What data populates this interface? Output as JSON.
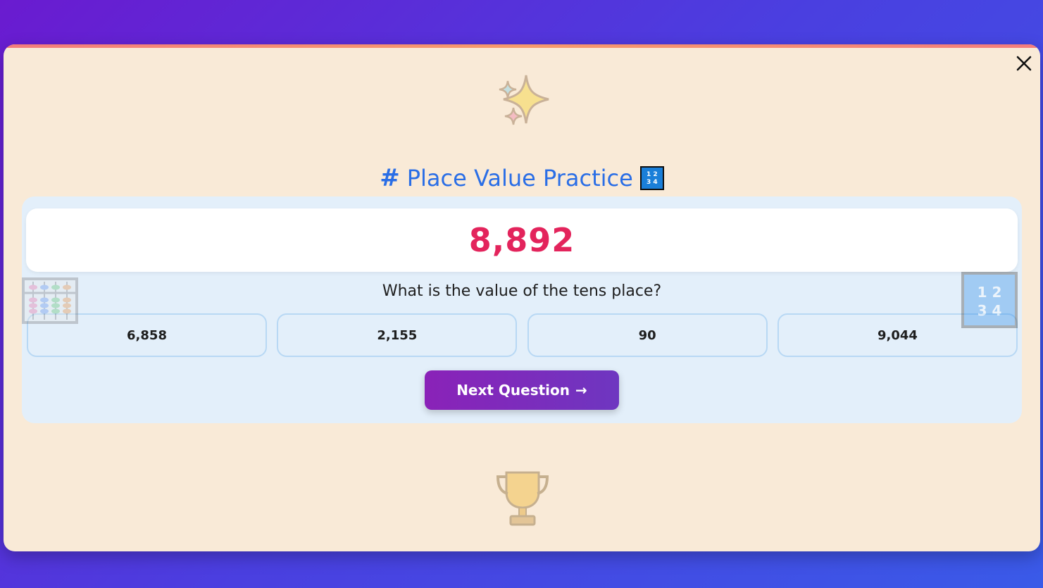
{
  "app": {
    "title": "Place Value Practice",
    "title_prefix": "#",
    "close_label": "X"
  },
  "quiz": {
    "number": "8,892",
    "question": "What is the value of the tens place?",
    "options": [
      {
        "label": "6,858"
      },
      {
        "label": "2,155"
      },
      {
        "label": "90"
      },
      {
        "label": "9,044"
      }
    ],
    "next_label": "Next Question",
    "next_arrow": "→"
  },
  "decor": {
    "numpad_glyph": "1 2\n3 4",
    "icons": [
      "sparkles-icon",
      "trophy-icon",
      "abacus-icon",
      "input-numbers-icon"
    ]
  },
  "colors": {
    "title": "#2a6ee6",
    "number": "#e3245c",
    "button_start": "#8a22b8",
    "button_end": "#6e36c0",
    "modal_bg": "#f9ead7",
    "panel_bg": "#e3effa"
  }
}
